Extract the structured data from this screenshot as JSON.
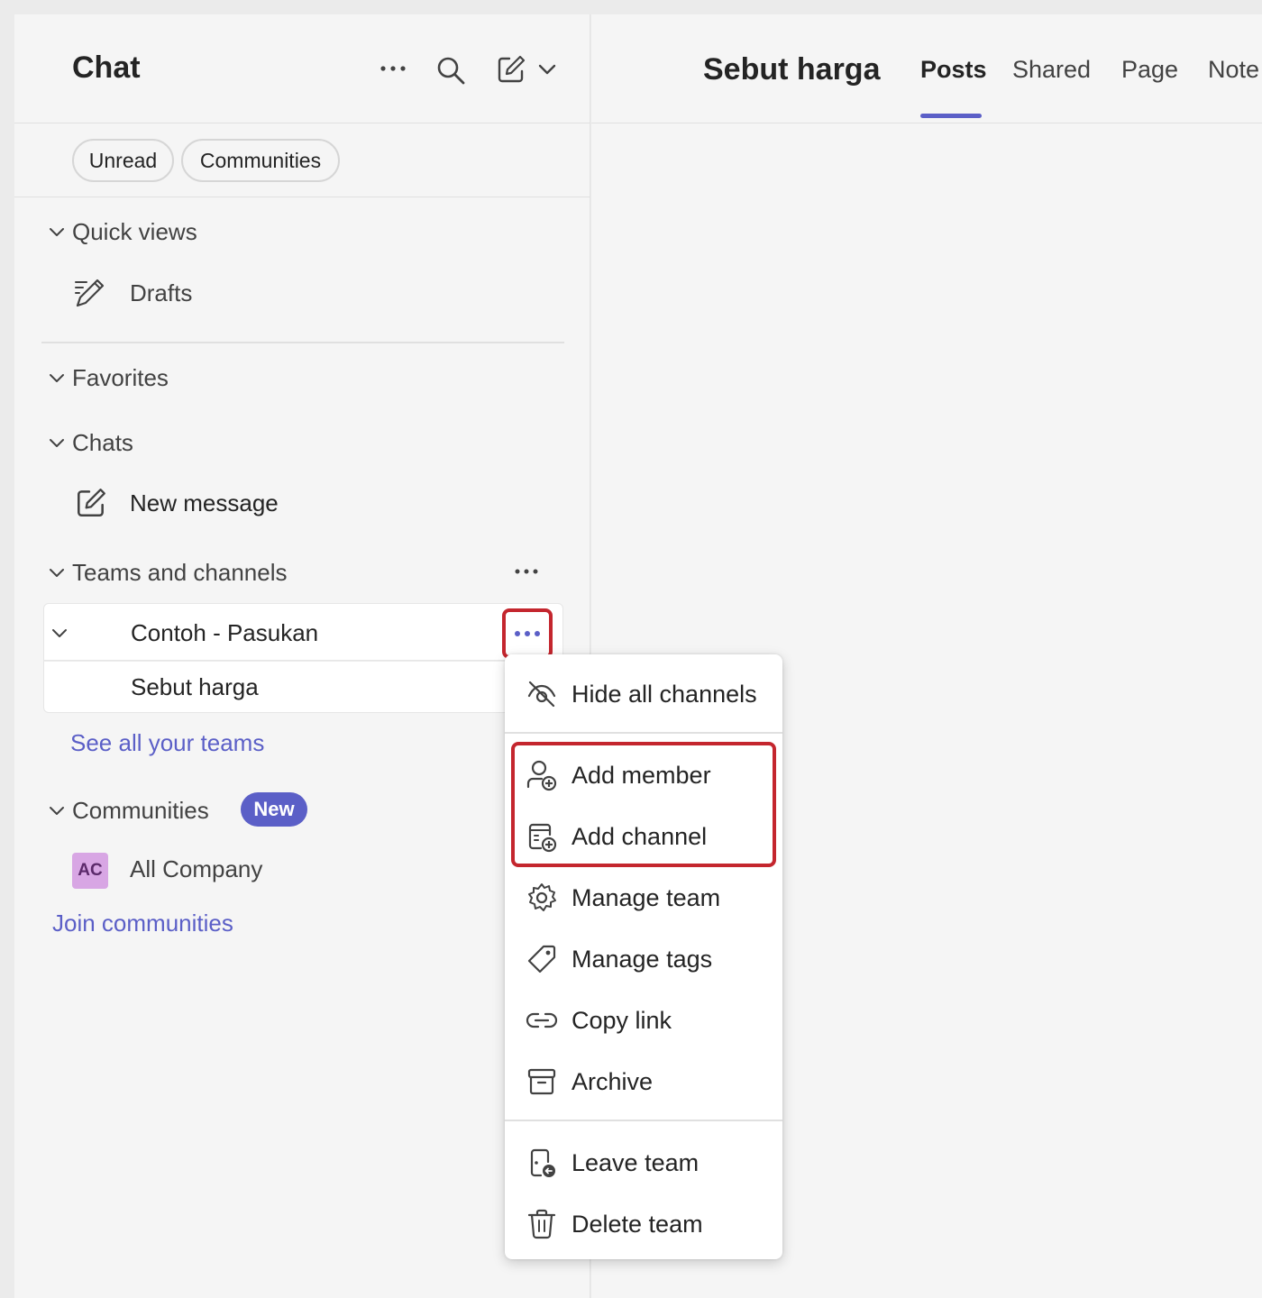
{
  "sidebar": {
    "title": "Chat",
    "header_icons": [
      "more-horizontal-icon",
      "search-icon",
      "compose-icon",
      "chevron-down-icon"
    ],
    "filters": [
      "Unread",
      "Communities"
    ],
    "quick_views": {
      "label": "Quick views",
      "items": [
        {
          "label": "Drafts",
          "icon": "drafts-pen-icon"
        }
      ]
    },
    "favorites": {
      "label": "Favorites"
    },
    "chats": {
      "label": "Chats",
      "new_message": "New message"
    },
    "teams": {
      "label": "Teams and channels",
      "team_name": "Contoh - Pasukan",
      "channel_name": "Sebut harga",
      "see_all": "See all your teams"
    },
    "communities": {
      "label": "Communities",
      "badge": "New",
      "item": {
        "initials": "AC",
        "name": "All Company"
      },
      "join": "Join communities"
    }
  },
  "main": {
    "channel_title": "Sebut harga",
    "tabs": [
      {
        "label": "Posts",
        "active": true
      },
      {
        "label": "Shared",
        "active": false
      },
      {
        "label": "Page",
        "active": false
      },
      {
        "label": "Note",
        "active": false
      }
    ]
  },
  "context_menu": {
    "items": [
      {
        "label": "Hide all channels",
        "icon": "eye-off-icon"
      },
      {
        "label": "Add member",
        "icon": "person-add-icon"
      },
      {
        "label": "Add channel",
        "icon": "channel-add-icon"
      },
      {
        "label": "Manage team",
        "icon": "gear-icon"
      },
      {
        "label": "Manage tags",
        "icon": "tag-icon"
      },
      {
        "label": "Copy link",
        "icon": "link-icon"
      },
      {
        "label": "Archive",
        "icon": "archive-icon"
      },
      {
        "label": "Leave team",
        "icon": "leave-icon"
      },
      {
        "label": "Delete team",
        "icon": "trash-icon"
      }
    ]
  },
  "colors": {
    "accent": "#5b5fc7",
    "highlight": "#c4262e",
    "sidebar_bg": "#f5f5f5",
    "avatar_bg": "#d8a6e4"
  }
}
